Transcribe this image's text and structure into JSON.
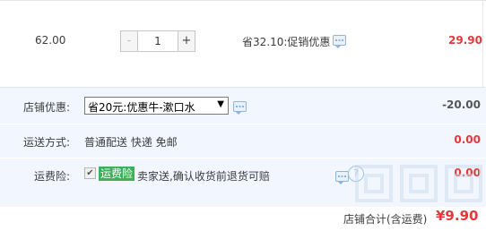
{
  "item": {
    "unit_price": "62.00",
    "quantity": "1",
    "minus_label": "-",
    "plus_label": "+",
    "promo_text": "省32.10:促销优惠",
    "subtotal": "29.90"
  },
  "shop_discount": {
    "label": "店铺优惠:",
    "selected_option": "省20元:优惠牛-漱口水",
    "amount": "-20.00"
  },
  "shipping": {
    "label": "运送方式:",
    "method": "普通配送 快递 免邮",
    "amount": "0.00"
  },
  "insurance": {
    "label": "运费险:",
    "checkbox_mark": "✔",
    "badge": "运费险",
    "description": "卖家送,确认收货前退货可赔",
    "amount": "0.00",
    "help_glyph": "?"
  },
  "total": {
    "label": "店铺合计(含运费)",
    "amount": "¥9.90"
  },
  "colors": {
    "accent_red": "#e4393c",
    "panel_blue": "#f2f7ff",
    "badge_green": "#3ab15a"
  }
}
